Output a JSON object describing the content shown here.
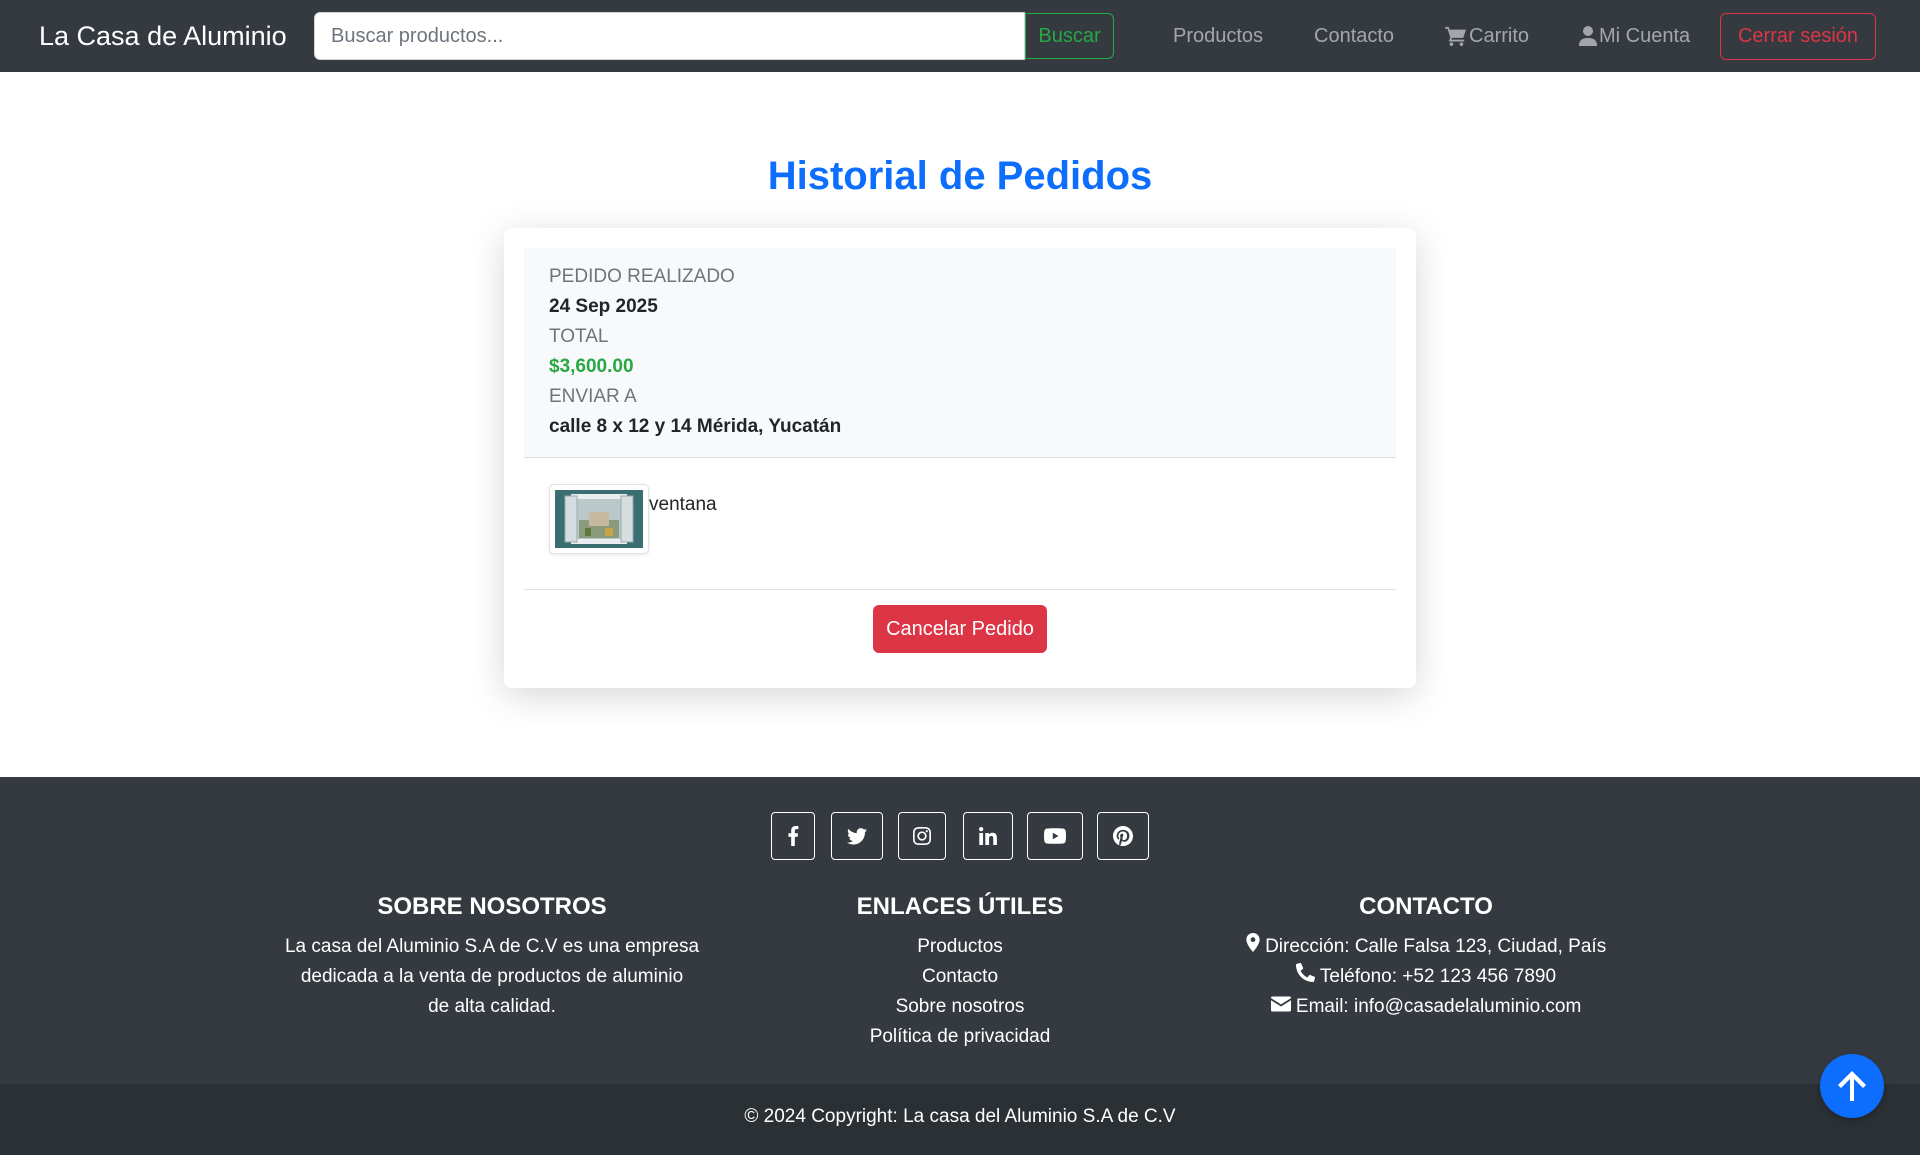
{
  "navbar": {
    "brand": "La Casa de Aluminio",
    "search_placeholder": "Buscar productos...",
    "search_button": "Buscar",
    "links": {
      "productos": "Productos",
      "contacto": "Contacto",
      "carrito": "Carrito",
      "cuenta": "Mi Cuenta"
    },
    "logout": "Cerrar sesión",
    "colors": {
      "background": "#343a40",
      "search_accent": "#28a745",
      "logout_accent": "#dc3545"
    },
    "icons": {
      "carrito": "cart-icon",
      "cuenta": "user-icon"
    }
  },
  "main": {
    "title": "Historial de Pedidos",
    "title_color": "#0d6efd",
    "order": {
      "placed_label": "PEDIDO REALIZADO",
      "placed_date": "24 Sep 2025",
      "total_label": "TOTAL",
      "total_value": "$3,600.00",
      "total_color": "#28a745",
      "ship_label": "ENVIAR A",
      "ship_address": "calle 8 x 12 y 14 Mérida, Yucatán",
      "items": [
        {
          "name": "ventana",
          "image": "window-thumbnail"
        }
      ],
      "cancel_button": "Cancelar Pedido",
      "cancel_color": "#dc3545"
    }
  },
  "footer": {
    "social": [
      "facebook-icon",
      "twitter-icon",
      "instagram-icon",
      "linkedin-icon",
      "youtube-icon",
      "pinterest-icon"
    ],
    "about": {
      "heading": "SOBRE NOSOTROS",
      "text_lines": [
        "La casa del Aluminio S.A de C.V es una empresa",
        "dedicada a la venta de productos de aluminio",
        "de alta calidad."
      ]
    },
    "links": {
      "heading": "ENLACES ÚTILES",
      "items": [
        "Productos",
        "Contacto",
        "Sobre nosotros",
        "Política de privacidad"
      ]
    },
    "contact": {
      "heading": "CONTACTO",
      "address": "Dirección: Calle Falsa 123, Ciudad, País",
      "phone": "Teléfono: +52 123 456 7890",
      "email": "Email: info@casadelaluminio.com"
    },
    "copyright": "© 2024 Copyright: La casa del Aluminio S.A de C.V",
    "colors": {
      "background": "#343a40",
      "copyright_background": "#2b3035",
      "back_to_top": "#0d6efd"
    }
  }
}
